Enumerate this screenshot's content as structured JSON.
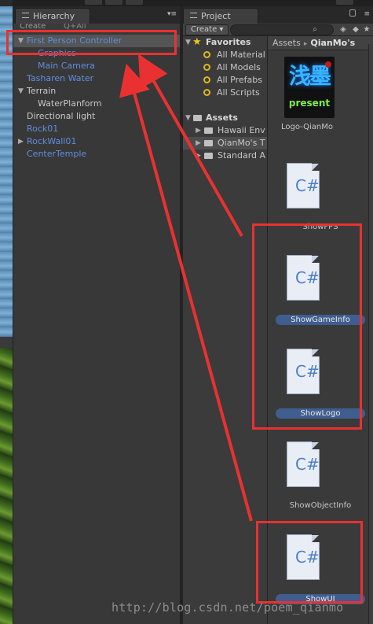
{
  "hierarchy": {
    "tab_label": "Hierarchy",
    "create_label": "Create",
    "search_label": "Q+All",
    "items": [
      {
        "label": "First Person Controller",
        "indent": 0,
        "expand": "down",
        "color": "blue",
        "selected": true
      },
      {
        "label": "Graphics",
        "indent": 1,
        "expand": "",
        "color": "blue",
        "selected": false
      },
      {
        "label": "Main Camera",
        "indent": 1,
        "expand": "",
        "color": "blue",
        "selected": false
      },
      {
        "label": "Tasharen Water",
        "indent": 0,
        "expand": "",
        "color": "blue",
        "selected": false
      },
      {
        "label": "Terrain",
        "indent": 0,
        "expand": "down",
        "color": "plain",
        "selected": false
      },
      {
        "label": "WaterPlanform",
        "indent": 1,
        "expand": "",
        "color": "plain",
        "selected": false
      },
      {
        "label": "Directional light",
        "indent": 0,
        "expand": "",
        "color": "plain",
        "selected": false
      },
      {
        "label": "Rock01",
        "indent": 0,
        "expand": "",
        "color": "blue",
        "selected": false
      },
      {
        "label": "RockWall01",
        "indent": 0,
        "expand": "right",
        "color": "blue",
        "selected": false
      },
      {
        "label": "CenterTemple",
        "indent": 0,
        "expand": "",
        "color": "blue",
        "selected": false
      }
    ]
  },
  "project": {
    "tab_label": "Project",
    "create_label": "Create",
    "favorites_label": "Favorites",
    "favorites": [
      "All Material",
      "All Models",
      "All Prefabs",
      "All Scripts"
    ],
    "assets_label": "Assets",
    "folders": [
      {
        "label": "Hawaii Env",
        "selected": false
      },
      {
        "label": "QianMo's T",
        "selected": true
      },
      {
        "label": "Standard A",
        "selected": false
      }
    ],
    "breadcrumb": {
      "root": "Assets",
      "current": "QianMo's"
    },
    "assets": [
      {
        "label": "Logo-QianMo",
        "kind": "logo",
        "highlight": false
      },
      {
        "label": "ShowFPS",
        "kind": "script",
        "highlight": false
      },
      {
        "label": "ShowGameInfo",
        "kind": "script",
        "highlight": true
      },
      {
        "label": "ShowLogo",
        "kind": "script",
        "highlight": true
      },
      {
        "label": "ShowObjectInfo",
        "kind": "script",
        "highlight": false
      },
      {
        "label": "ShowUI",
        "kind": "script",
        "highlight": true
      }
    ],
    "logo_text": {
      "chinese": "浅墨",
      "present": "present"
    },
    "script_glyph": "C#"
  },
  "watermark": "http://blog.csdn.net/poem_qianmo",
  "annotation_color": "#e93131"
}
